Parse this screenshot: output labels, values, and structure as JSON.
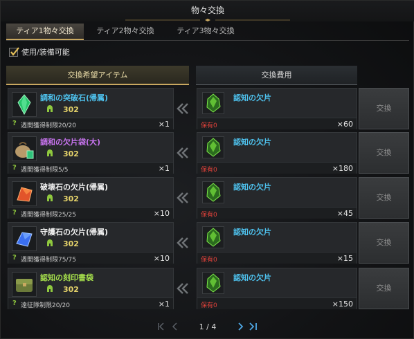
{
  "window": {
    "title": "物々交換"
  },
  "tabs": [
    {
      "label": "ティア1物々交換",
      "active": true
    },
    {
      "label": "ティア2物々交換",
      "active": false
    },
    {
      "label": "ティア3物々交換",
      "active": false
    }
  ],
  "filter": {
    "label": "使用/装備可能",
    "checked": true
  },
  "headers": {
    "left": "交換希望アイテム",
    "right": "交換費用"
  },
  "rows": [
    {
      "item_name": "調和の突破石(帰属)",
      "item_color": "#4ec2ee",
      "item_icon": "crystal-icon",
      "currency_icon": "helmet-icon",
      "currency_value": "302",
      "limit": "週間獲得制限20/20",
      "item_qty": "×1",
      "cost_name": "認知の欠片",
      "cost_icon": "green-shard-icon",
      "owned": "保有0",
      "cost_qty": "×60",
      "button": "交換"
    },
    {
      "item_name": "調和の欠片袋(大)",
      "item_color": "#c874f0",
      "item_icon": "bag-icon",
      "currency_icon": "helmet-icon",
      "currency_value": "302",
      "limit": "週間獲得制限5/5",
      "item_qty": "×1",
      "cost_name": "認知の欠片",
      "cost_icon": "green-shard-icon",
      "owned": "保有0",
      "cost_qty": "×180",
      "button": "交換"
    },
    {
      "item_name": "破壊石の欠片(帰属)",
      "item_color": "#f0f0f0",
      "item_icon": "red-gem-icon",
      "currency_icon": "helmet-icon",
      "currency_value": "302",
      "limit": "週間獲得制限25/25",
      "item_qty": "×10",
      "cost_name": "認知の欠片",
      "cost_icon": "green-shard-icon",
      "owned": "保有0",
      "cost_qty": "×45",
      "button": "交換"
    },
    {
      "item_name": "守護石の欠片(帰属)",
      "item_color": "#f0f0f0",
      "item_icon": "blue-gem-icon",
      "currency_icon": "helmet-icon",
      "currency_value": "302",
      "limit": "週間獲得制限75/75",
      "item_qty": "×10",
      "cost_name": "認知の欠片",
      "cost_icon": "green-shard-icon",
      "owned": "保有0",
      "cost_qty": "×15",
      "button": "交換"
    },
    {
      "item_name": "認知の刻印書袋",
      "item_color": "#a6e04c",
      "item_icon": "satchel-icon",
      "currency_icon": "helmet-icon",
      "currency_value": "302",
      "limit": "遠征隊制限20/20",
      "item_qty": "×1",
      "cost_name": "認知の欠片",
      "cost_icon": "green-shard-icon",
      "owned": "保有0",
      "cost_qty": "×150",
      "button": "交換"
    }
  ],
  "pagination": {
    "text": "1 / 4"
  }
}
